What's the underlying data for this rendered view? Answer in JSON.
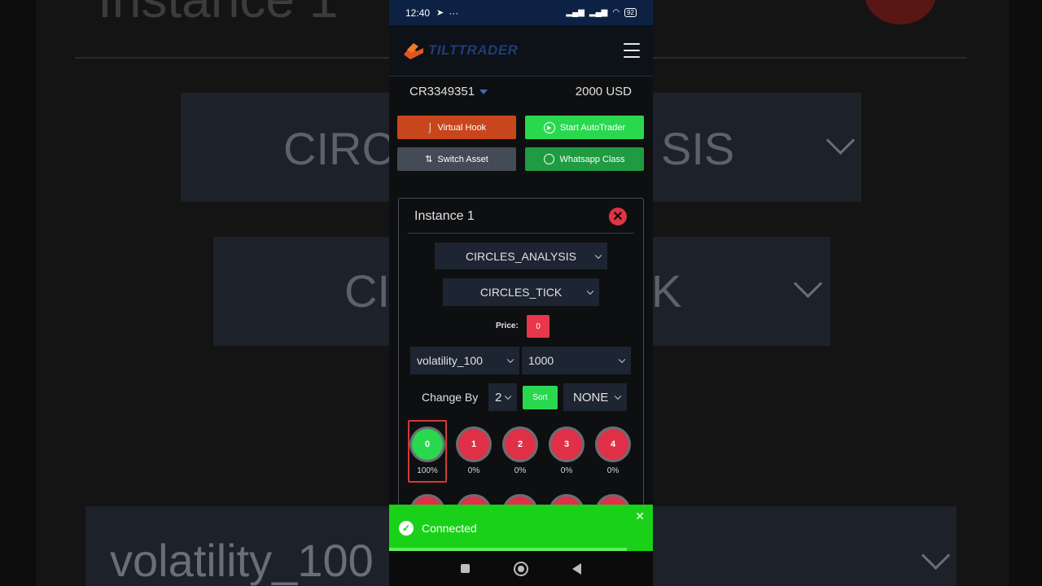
{
  "background": {
    "title": "Instance 1",
    "analysis_text": "CIRC",
    "analysis_text_right": "SIS",
    "tick_text": "CI",
    "tick_text_right": "K",
    "asset_text": "volatility_100"
  },
  "status_bar": {
    "time": "12:40",
    "battery": "92"
  },
  "app": {
    "logo_text": "TILTTRADER",
    "account_id": "CR3349351",
    "balance": "2000 USD"
  },
  "actions": {
    "virtual_hook": "Virtual Hook",
    "start_autotrader": "Start AutoTrader",
    "switch_asset": "Switch Asset",
    "whatsapp_class": "Whatsapp Class"
  },
  "instance": {
    "title": "Instance 1",
    "analysis_select": "CIRCLES_ANALYSIS",
    "tick_select": "CIRCLES_TICK",
    "price_label": "Price:",
    "price_value": "0",
    "asset_select": "volatility_100",
    "stake_select": "1000",
    "change_by_label": "Change By",
    "change_by_value": "2",
    "sort_label": "Sort",
    "filter_select": "NONE",
    "digits": [
      {
        "digit": "0",
        "percent": "100%",
        "color": "#2ad84f"
      },
      {
        "digit": "1",
        "percent": "0%",
        "color": "#e03048"
      },
      {
        "digit": "2",
        "percent": "0%",
        "color": "#e03048"
      },
      {
        "digit": "3",
        "percent": "0%",
        "color": "#e03048"
      },
      {
        "digit": "4",
        "percent": "0%",
        "color": "#e03048"
      }
    ]
  },
  "toast": {
    "message": "Connected",
    "progress_fraction": 0.9
  },
  "colors": {
    "accent_red": "#e03048",
    "accent_green": "#2ad84f",
    "toast_green": "#19d119"
  }
}
